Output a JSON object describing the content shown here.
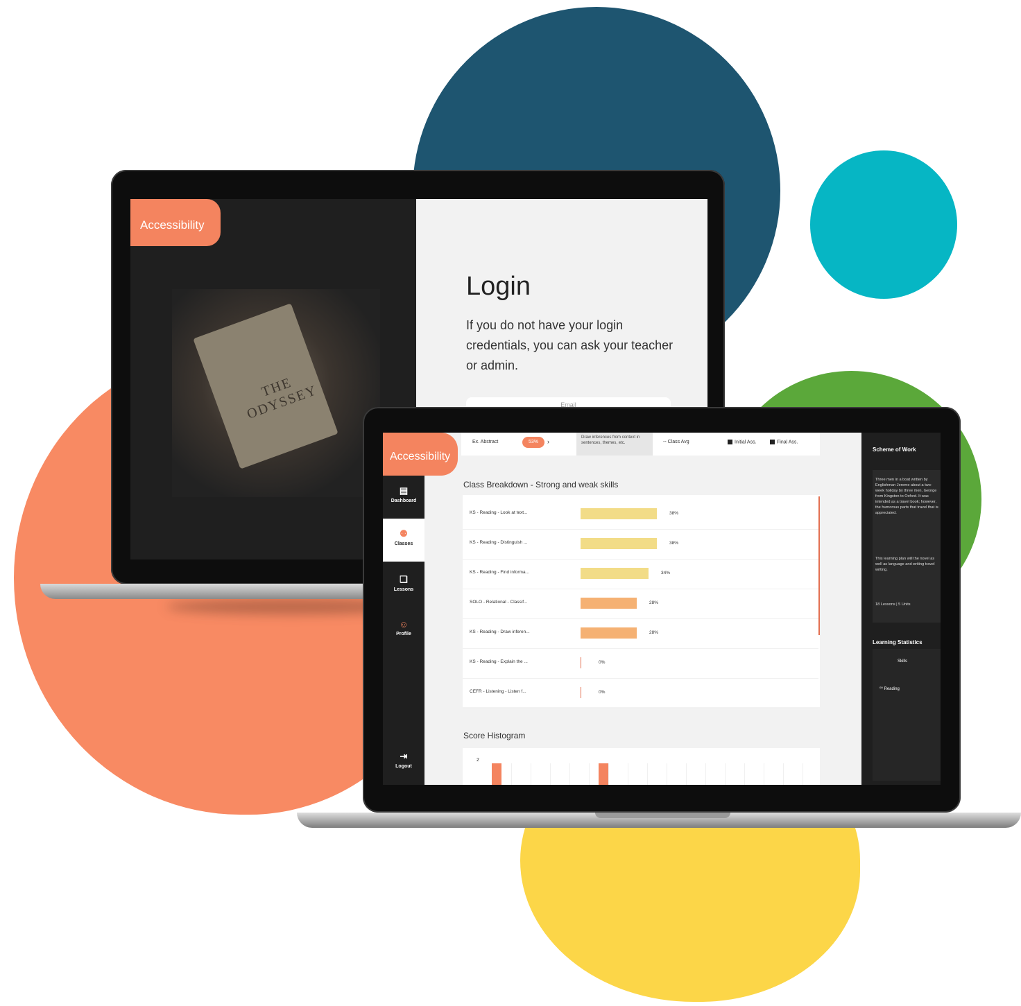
{
  "colors": {
    "accent": "#f4845f",
    "navy": "#1e5570",
    "teal": "#06b6c4",
    "green": "#5ba83a",
    "coral": "#f88a63",
    "yellow": "#fcd648",
    "bar_light": "#f2dc87",
    "bar_orange": "#f5b173"
  },
  "login_screen": {
    "logo": "Accessibility",
    "book_title": "THE ODYSSEY",
    "title": "Login",
    "text": "If you do not have your login credentials, you can ask your teacher or admin.",
    "field_label": "Email"
  },
  "dashboard": {
    "logo": "Accessibility",
    "nav": [
      {
        "label": "Dashboard",
        "icon": "dashboard-icon"
      },
      {
        "label": "Classes",
        "icon": "classes-icon"
      },
      {
        "label": "Lessons",
        "icon": "lessons-icon"
      },
      {
        "label": "Profile",
        "icon": "profile-icon"
      },
      {
        "label": "Logout",
        "icon": "logout-icon"
      }
    ],
    "topbar": {
      "label": "Ex. Abstract",
      "pill": "53%",
      "box_text": "Draw inferences from context in sentences, themes, etc.",
      "class_avg": "Class Avg",
      "initial": "Initial Ass.",
      "final": "Final Ass."
    },
    "breakdown_title": "Class Breakdown - Strong and weak skills",
    "skills": [
      {
        "label": "KS - Reading - Look at text...",
        "value": 38,
        "pct": "38%"
      },
      {
        "label": "KS - Reading - Distinguish ...",
        "value": 38,
        "pct": "38%"
      },
      {
        "label": "KS - Reading - Find informa...",
        "value": 34,
        "pct": "34%"
      },
      {
        "label": "SOLO - Relational - Classif...",
        "value": 28,
        "pct": "28%"
      },
      {
        "label": "KS - Reading - Draw inferen...",
        "value": 28,
        "pct": "28%"
      },
      {
        "label": "KS - Reading - Explain the ...",
        "value": 0,
        "pct": "0%"
      },
      {
        "label": "CEFR - Listening - Listen f...",
        "value": 0,
        "pct": "0%"
      }
    ],
    "histogram": {
      "title": "Score Histogram",
      "y_label": "2"
    },
    "scheme": {
      "title": "Scheme of Work",
      "desc1": "Three men in a boat written by Englishman Jerome about a two-week holiday by three men, George from Kingston to Oxford. It was intended as a travel book; however, the humorous parts that travel that is appreciated.",
      "desc2": "This learning plan will the novel as well as language and writing travel writing.",
      "meta": "18 Lessons | 5 Units"
    },
    "stats": {
      "title": "Learning Statistics",
      "skills": "Skills",
      "reading": "Reading"
    }
  }
}
